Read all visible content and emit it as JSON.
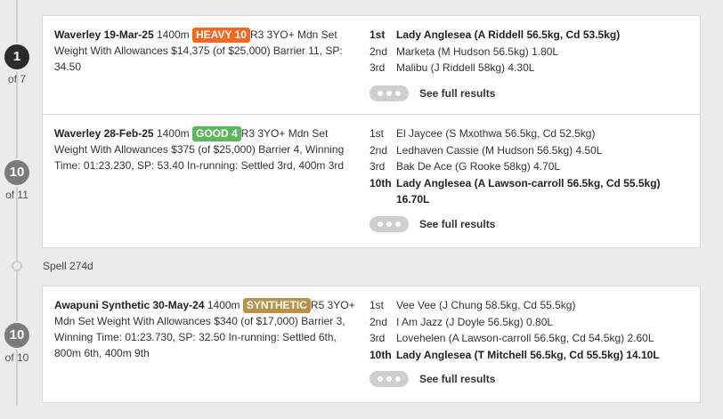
{
  "races": [
    {
      "position": "1",
      "of_label": "of 7",
      "venue_date": "Waverley 19-Mar-25",
      "distance": "1400m",
      "track": {
        "label": "HEAVY 10",
        "color": "#f26a21"
      },
      "description": "R3 3YO+ Mdn Set Weight With Allowances $14,375 (of $25,000) Barrier 11, SP: 34.50",
      "results": [
        {
          "place": "1st",
          "text": "Lady Anglesea (A Riddell 56.5kg, Cd 53.5kg)",
          "bold": true
        },
        {
          "place": "2nd",
          "text": "Marketa (M Hudson 56.5kg) 1.80L",
          "bold": false
        },
        {
          "place": "3rd",
          "text": "Malibu (J Riddell 58kg) 4.30L",
          "bold": false
        }
      ],
      "full_results_label": "See full results"
    },
    {
      "position": "10",
      "of_label": "of 11",
      "venue_date": "Waverley 28-Feb-25",
      "distance": "1400m",
      "track": {
        "label": "GOOD 4",
        "color": "#5cb85c"
      },
      "description": "R3 3YO+ Mdn Set Weight With Allowances $375 (of $25,000) Barrier 4, Winning Time: 01:23.230, SP: 53.40 In-running: Settled 3rd, 400m 3rd",
      "results": [
        {
          "place": "1st",
          "text": "El Jaycee (S Mxothwa 56.5kg, Cd 52.5kg)",
          "bold": false
        },
        {
          "place": "2nd",
          "text": "Ledhaven Cassie (M Hudson 56.5kg) 4.50L",
          "bold": false
        },
        {
          "place": "3rd",
          "text": "Bak De Ace (G Rooke 58kg) 4.70L",
          "bold": false
        },
        {
          "place": "10th",
          "text": "Lady Anglesea (A Lawson-carroll 56.5kg, Cd 55.5kg) 16.70L",
          "bold": true
        }
      ],
      "full_results_label": "See full results"
    },
    {
      "position": "10",
      "of_label": "of 10",
      "venue_date": "Awapuni Synthetic 30-May-24",
      "distance": "1400m",
      "track": {
        "label": "SYNTHETIC",
        "color": "#b9924a"
      },
      "description": "R5 3YO+ Mdn Set Weight With Allowances $340 (of $17,000) Barrier 3, Winning Time: 01:23.730, SP: 32.50 In-running: Settled 6th, 800m 6th, 400m 9th",
      "results": [
        {
          "place": "1st",
          "text": "Vee Vee (J Chung 58.5kg, Cd 55.5kg)",
          "bold": false
        },
        {
          "place": "2nd",
          "text": "I Am Jazz (J Doyle 56.5kg) 0.80L",
          "bold": false
        },
        {
          "place": "3rd",
          "text": "Lovehelen (A Lawson-carroll 56.5kg, Cd 54.5kg) 2.60L",
          "bold": false
        },
        {
          "place": "10th",
          "text": "Lady Anglesea (T Mitchell 56.5kg, Cd 55.5kg) 14.10L",
          "bold": true
        }
      ],
      "full_results_label": "See full results"
    }
  ],
  "spell": {
    "label": "Spell 274d"
  }
}
